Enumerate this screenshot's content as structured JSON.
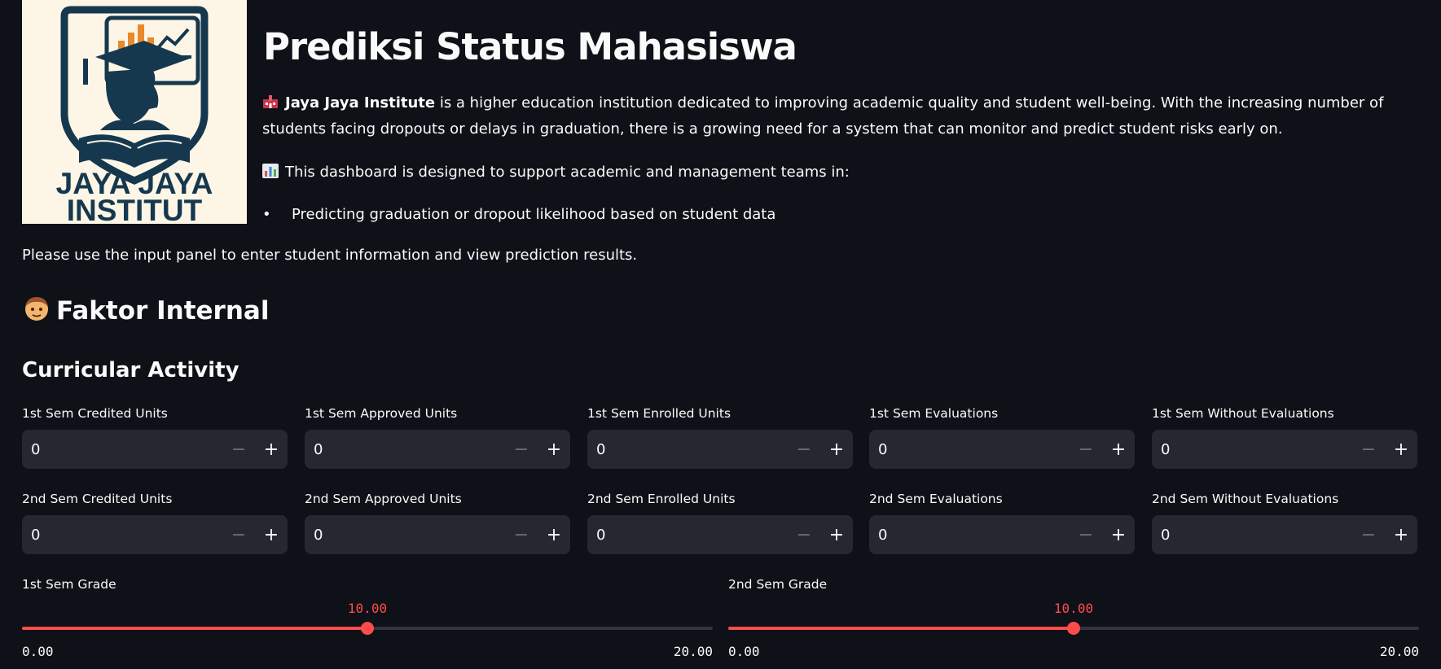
{
  "logo": {
    "line1": "JAYA JAYA",
    "line2": "INSTITUT"
  },
  "header": {
    "title": "Prediksi Status Mahasiswa"
  },
  "intro": {
    "institute_emoji": "school-icon",
    "institute_name": "Jaya Jaya Institute",
    "institute_text": " is a higher education institution dedicated to improving academic quality and student well-being. With the increasing number of students facing dropouts or delays in graduation, there is a growing need for a system that can monitor and predict student risks early on.",
    "dashboard_emoji": "bar-chart-icon",
    "dashboard_text": "This dashboard is designed to support academic and management teams in:",
    "bullets": [
      "Predicting graduation or dropout likelihood based on student data"
    ],
    "note": "Please use the input panel to enter student information and view prediction results."
  },
  "section": {
    "emoji": "person-icon",
    "title": "Faktor Internal",
    "subtitle": "Curricular Activity"
  },
  "inputs": [
    {
      "label": "1st Sem Credited Units",
      "value": "0"
    },
    {
      "label": "1st Sem Approved Units",
      "value": "0"
    },
    {
      "label": "1st Sem Enrolled Units",
      "value": "0"
    },
    {
      "label": "1st Sem Evaluations",
      "value": "0"
    },
    {
      "label": "1st Sem Without Evaluations",
      "value": "0"
    },
    {
      "label": "2nd Sem Credited Units",
      "value": "0"
    },
    {
      "label": "2nd Sem Approved Units",
      "value": "0"
    },
    {
      "label": "2nd Sem Enrolled Units",
      "value": "0"
    },
    {
      "label": "2nd Sem Evaluations",
      "value": "0"
    },
    {
      "label": "2nd Sem Without Evaluations",
      "value": "0"
    }
  ],
  "stepper": {
    "minus": "−",
    "plus": "+"
  },
  "sliders": [
    {
      "label": "1st Sem Grade",
      "value": 10.0,
      "value_text": "10.00",
      "min": 0.0,
      "min_text": "0.00",
      "max": 20.0,
      "max_text": "20.00"
    },
    {
      "label": "2nd Sem Grade",
      "value": 10.0,
      "value_text": "10.00",
      "min": 0.0,
      "min_text": "0.00",
      "max": 20.0,
      "max_text": "20.00"
    }
  ],
  "colors": {
    "background": "#0e1117",
    "accent": "#ff4b4b",
    "input_bg": "#262730",
    "logo_navy": "#16384f",
    "logo_orange": "#e8892b"
  }
}
